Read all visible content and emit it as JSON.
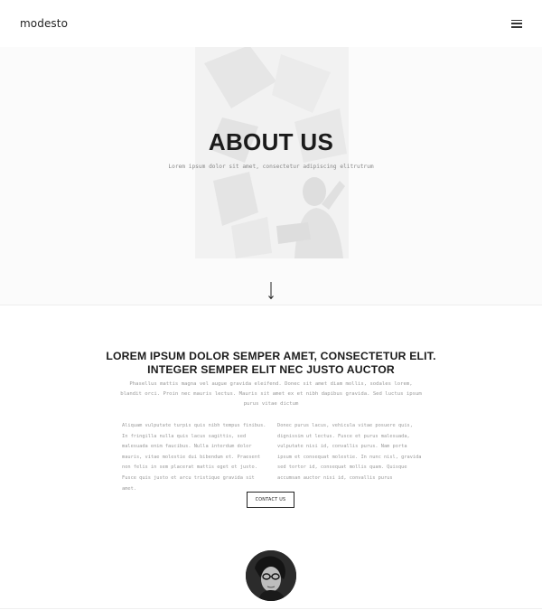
{
  "header": {
    "logo": "modesto",
    "menu_icon": "hamburger-menu-icon"
  },
  "hero": {
    "title": "ABOUT US",
    "subtitle": "Lorem ipsum dolor sit amet, consectetur adipiscing elitrutrum",
    "scroll_icon": "arrow-down-icon"
  },
  "about": {
    "heading_line1": "LOREM IPSUM DOLOR SEMPER AMET, CONSECTETUR ELIT.",
    "heading_line2": "INTEGER SEMPER ELIT NEC JUSTO AUCTOR",
    "intro": "Phasellus mattis magna vel augue gravida eleifend. Donec sit amet diam mollis, sodales lorem, blandit orci. Proin nec mauris lectus. Mauris sit amet ex et nibh dapibus gravida. Sed luctus ipsum purus vitae dictum",
    "column_left": "Aliquam vulputate turpis quis nibh tempus finibus. In fringilla nulla quis lacus sagittis, sed malesuada enim faucibus. Nulla interdum dolor mauris, vitae molestie dui bibendum et. Praesent non felis in sem placerat mattis eget et justo. Fusce quis justo et arcu tristique gravida sit amet.",
    "column_right": "Donec purus lacus, vehicula vitae posuere quis, dignissim ut lectus. Fusce et purus malesuada, vulputate nisi id, convallis purus. Nam porta ipsum et consequat molestie. In nunc nisl, gravida sed tortor id, consequat mollis quam. Quisque accumsan auctor nisi id, convallis purus",
    "button_label": "CONTACT US"
  },
  "colors": {
    "text_dark": "#1b1b1b",
    "text_muted": "#999999",
    "hero_bg": "#fbfbfb"
  }
}
